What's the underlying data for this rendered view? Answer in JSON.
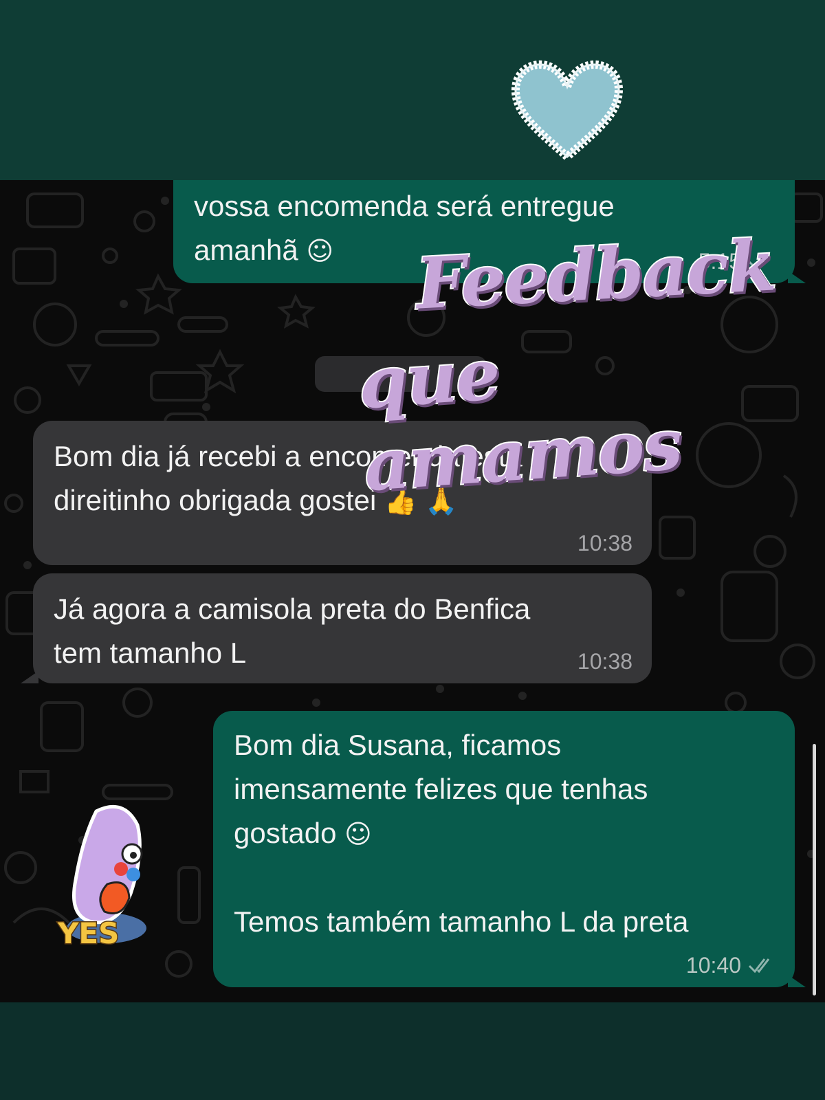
{
  "messages": [
    {
      "direction": "outgoing",
      "text": "vossa encomenda será entregue\namanhã",
      "emoji": "☺",
      "time": "5:15",
      "status": "read"
    },
    {
      "direction": "incoming",
      "text": "Bom dia já recebi a encomenda está\ndireitinho obrigada gostei",
      "emoji": "👍 🙏",
      "time": "10:38"
    },
    {
      "direction": "incoming",
      "text": "Já agora a camisola preta  do Benfica\ntem tamanho L",
      "time": "10:38"
    },
    {
      "direction": "outgoing",
      "text": "Bom dia Susana, ficamos\nimensamente felizes que tenhas\ngostado",
      "emoji": "☺",
      "text2": "Temos também tamanho L da preta",
      "time": "10:40",
      "status": "read"
    }
  ],
  "overlay": {
    "title_line1": "Feedback",
    "title_line2": "que amamos",
    "sticker_text": "YES",
    "heart_icon": "heart-icon"
  },
  "colors": {
    "outgoing_bubble": "#085b4c",
    "incoming_bubble": "#363638",
    "background": "#0f3d35",
    "title_fill": "#c7a6d9",
    "heart_fill": "#8fc3cf"
  }
}
